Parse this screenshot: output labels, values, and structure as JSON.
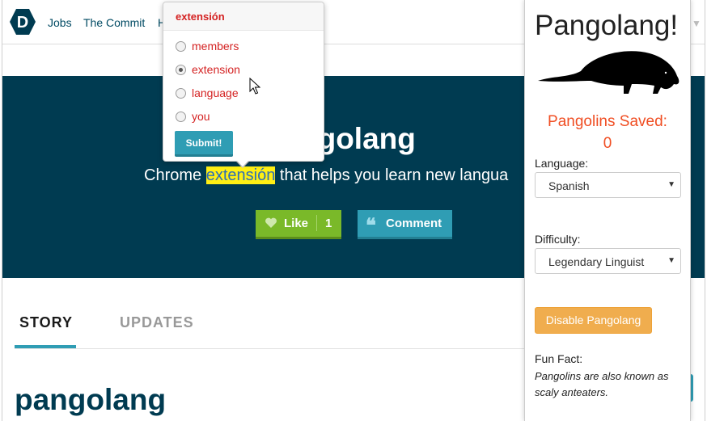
{
  "nav": {
    "logo_letter": "D",
    "links": [
      "Jobs",
      "The Commit",
      "H"
    ]
  },
  "hero": {
    "title": "ngolang",
    "tagline_before": "Chrome ",
    "tagline_highlight": "extensión",
    "tagline_after": " that helps you learn new langua",
    "like_label": "Like",
    "like_count": "1",
    "comment_label": "Comment"
  },
  "tabs": {
    "story": "STORY",
    "updates": "UPDATES"
  },
  "content": {
    "title": "pangolang"
  },
  "popup": {
    "word": "extensión",
    "options": [
      "members",
      "extension",
      "language",
      "you"
    ],
    "selected_index": 1,
    "submit_label": "Submit!"
  },
  "panel": {
    "title": "Pangolang!",
    "saved_label": "Pangolins Saved:",
    "saved_count": "0",
    "language_label": "Language:",
    "language_value": "Spanish",
    "difficulty_label": "Difficulty:",
    "difficulty_value": "Legendary Linguist",
    "disable_label": "Disable Pangolang",
    "fun_fact_label": "Fun Fact:",
    "fun_fact_text": "Pangolins are also known as scaly anteaters."
  },
  "colors": {
    "hero_bg": "#003b51",
    "accent_teal": "#2f9db4",
    "like_green": "#7ab929",
    "popup_red": "#d42222",
    "saved_orange": "#f04e23",
    "disable_orange": "#f0ad4e",
    "highlight_yellow": "#ffef14"
  },
  "icons": {
    "logo": "devpost-hexagon-logo",
    "heart": "heart-icon",
    "quote": "quote-icon",
    "pangolin": "pangolin-silhouette",
    "cursor": "mouse-pointer-icon"
  }
}
